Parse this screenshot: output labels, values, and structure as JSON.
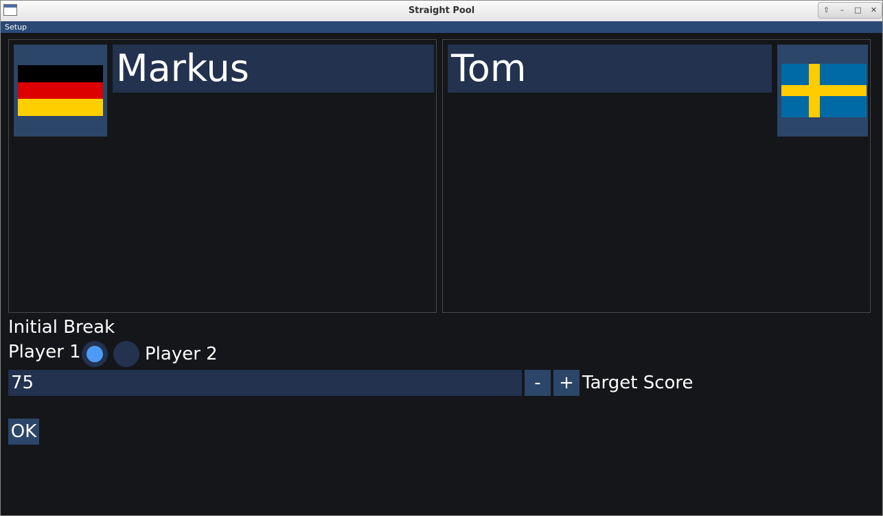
{
  "window": {
    "title": "Straight Pool"
  },
  "window_controls": [
    "⇧",
    "–",
    "□",
    "✕"
  ],
  "menu": {
    "items": [
      "Setup"
    ]
  },
  "player1": {
    "name": "Markus",
    "flag": "germany-flag"
  },
  "player2": {
    "name": "Tom",
    "flag": "sweden-flag"
  },
  "initial_break": {
    "heading": "Initial Break",
    "option1": "Player 1",
    "option2": "Player 2",
    "selected": "Player 1"
  },
  "target_score": {
    "value": "75",
    "minus_label": "-",
    "plus_label": "+",
    "label": "Target Score"
  },
  "ok_label": "OK",
  "colors": {
    "background": "#151619",
    "panel_field": "#22324f",
    "button": "#2b4669",
    "menubar": "#2a4a75",
    "radio_selected": "#4d9bf7",
    "de_black": "#000000",
    "de_red": "#dd0000",
    "de_gold": "#ffce00",
    "se_blue": "#006aa7",
    "se_yellow": "#fecc00"
  }
}
